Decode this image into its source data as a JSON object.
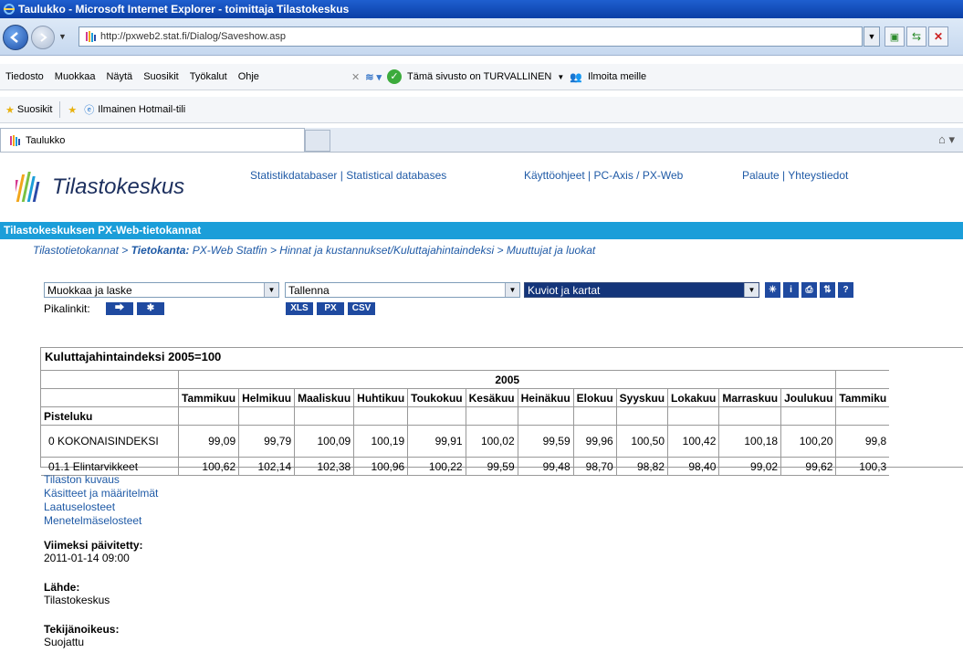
{
  "window": {
    "title": "Taulukko - Microsoft Internet Explorer - toimittaja Tilastokeskus"
  },
  "address": {
    "url": "http://pxweb2.stat.fi/Dialog/Saveshow.asp"
  },
  "menu": [
    "Tiedosto",
    "Muokkaa",
    "Näytä",
    "Suosikit",
    "Työkalut",
    "Ohje"
  ],
  "toolbar": {
    "safety": "Tämä sivusto on TURVALLINEN",
    "report": "Ilmoita meille"
  },
  "favorites": {
    "label": "Suosikit",
    "hotmail": "Ilmainen Hotmail-tili"
  },
  "tab": {
    "title": "Taulukko"
  },
  "site": {
    "brand": "Tilastokeskus",
    "links": [
      "Statistikdatabaser",
      "Statistical databases",
      "Käyttöohjeet",
      "PC-Axis / PX-Web",
      "Palaute",
      "Yhteystiedot"
    ],
    "banner": "Tilastokeskuksen PX-Web-tietokannat",
    "breadcrumb": {
      "a": "Tilastotietokannat",
      "b_bold": "Tietokanta:",
      "b": "PX-Web Statfin",
      "c": "Hinnat ja kustannukset/Kuluttajahintaindeksi",
      "d": "Muuttujat ja luokat"
    }
  },
  "controls": {
    "select1": "Muokkaa ja laske",
    "select2": "Tallenna",
    "select3": "Kuviot ja kartat",
    "quicklinks": "Pikalinkit:",
    "formats": [
      "XLS",
      "PX",
      "CSV"
    ]
  },
  "table": {
    "caption": "Kuluttajahintaindeksi 2005=100",
    "year": "2005",
    "months": [
      "Tammikuu",
      "Helmikuu",
      "Maaliskuu",
      "Huhtikuu",
      "Toukokuu",
      "Kesäkuu",
      "Heinäkuu",
      "Elokuu",
      "Syyskuu",
      "Lokakuu",
      "Marraskuu",
      "Joulukuu",
      "Tammiku"
    ],
    "stub": "Pisteluku",
    "rows": [
      {
        "label": "0 KOKONAISINDEKSI",
        "values": [
          "99,09",
          "99,79",
          "100,09",
          "100,19",
          "99,91",
          "100,02",
          "99,59",
          "99,96",
          "100,50",
          "100,42",
          "100,18",
          "100,20",
          "99,8"
        ]
      },
      {
        "label": "01.1 Elintarvikkeet",
        "values": [
          "100,62",
          "102,14",
          "102,38",
          "100,96",
          "100,22",
          "99,59",
          "99,48",
          "98,70",
          "98,82",
          "98,40",
          "99,02",
          "99,62",
          "100,3"
        ]
      }
    ]
  },
  "infolinks": [
    "Tilaston kuvaus",
    "Käsitteet ja määritelmät",
    "Laatuselosteet",
    "Menetelmäselosteet"
  ],
  "meta": {
    "updated_label": "Viimeksi päivitetty:",
    "updated": "2011-01-14 09:00",
    "source_label": "Lähde:",
    "source": "Tilastokeskus",
    "copyright_label": "Tekijänoikeus:",
    "copyright": "Suojattu"
  }
}
